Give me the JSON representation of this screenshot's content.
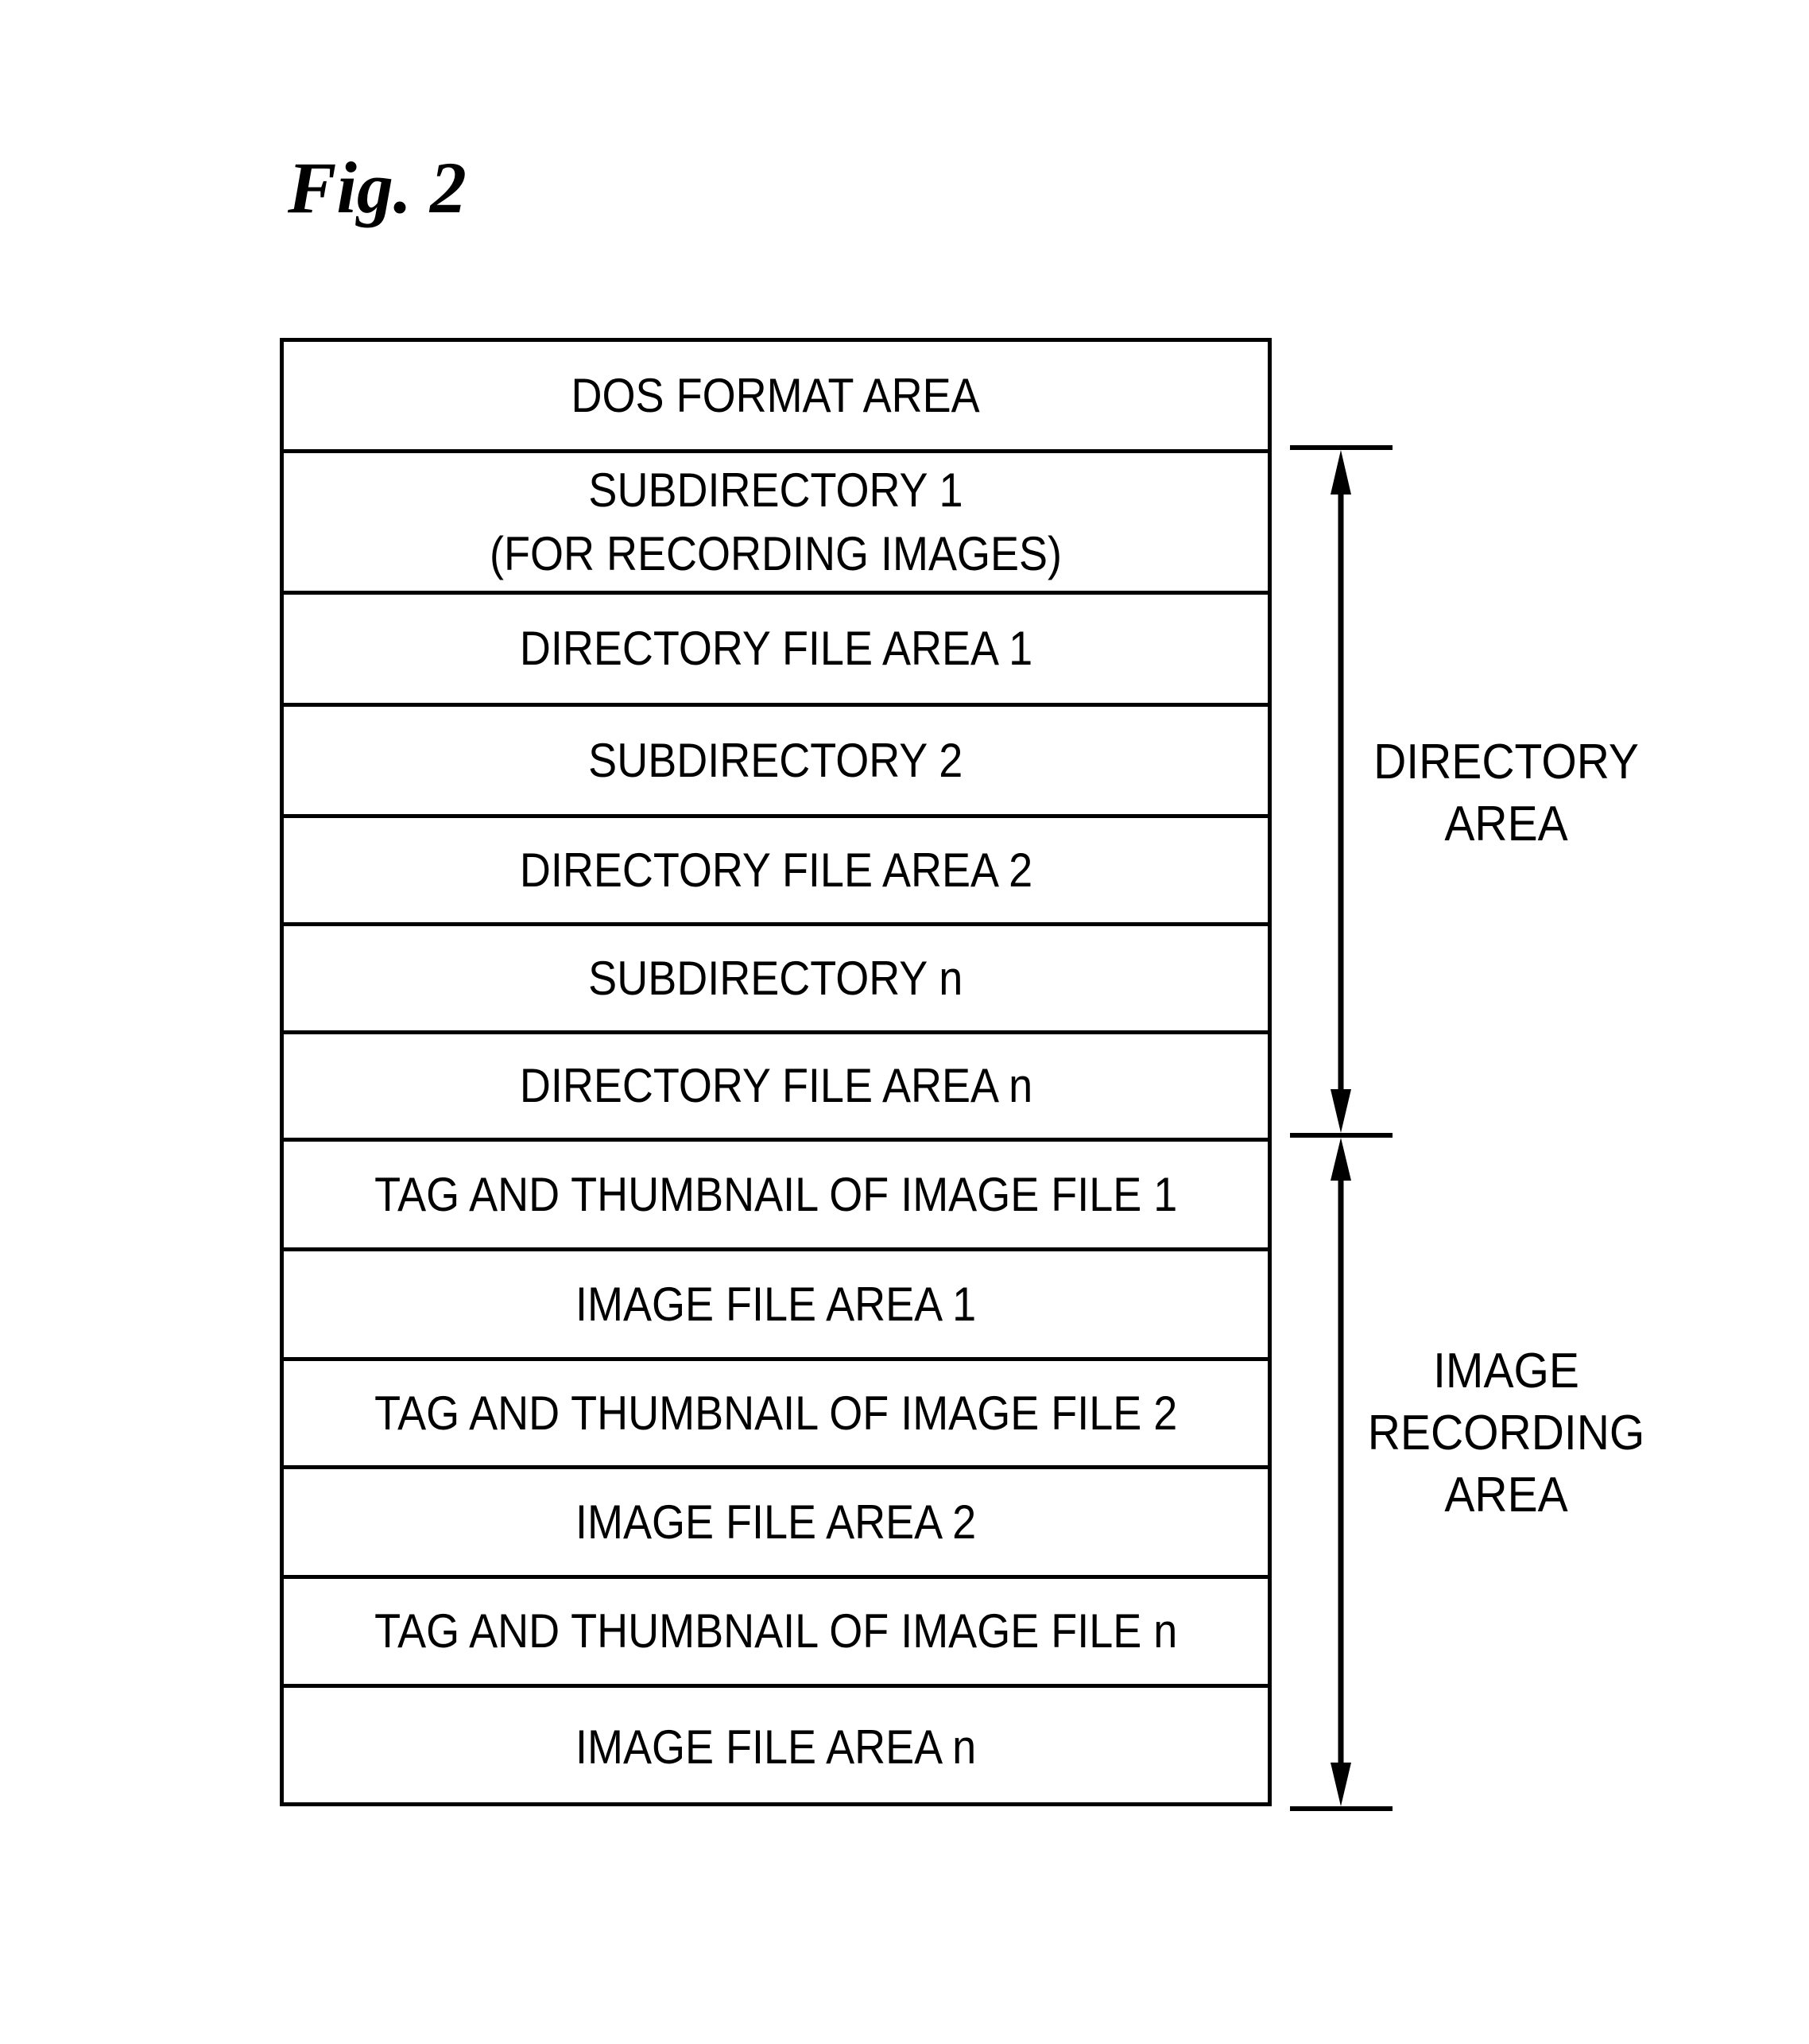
{
  "figure": {
    "title": "Fig. 2"
  },
  "memory_layout": {
    "rows": [
      {
        "label": "DOS FORMAT AREA"
      },
      {
        "label": "SUBDIRECTORY 1\n(FOR RECORDING IMAGES)"
      },
      {
        "label": "DIRECTORY FILE AREA 1"
      },
      {
        "label": "SUBDIRECTORY 2"
      },
      {
        "label": "DIRECTORY FILE AREA 2"
      },
      {
        "label": "SUBDIRECTORY n"
      },
      {
        "label": "DIRECTORY FILE AREA n"
      },
      {
        "label": "TAG AND THUMBNAIL OF IMAGE FILE 1"
      },
      {
        "label": "IMAGE FILE AREA 1"
      },
      {
        "label": "TAG AND THUMBNAIL OF IMAGE FILE 2"
      },
      {
        "label": "IMAGE FILE AREA 2"
      },
      {
        "label": "TAG AND THUMBNAIL OF IMAGE FILE n"
      },
      {
        "label": "IMAGE FILE AREA n"
      }
    ]
  },
  "regions": {
    "directory_area": {
      "lines": [
        "DIRECTORY",
        "AREA"
      ],
      "spans_rows": "SUBDIRECTORY 1 to DIRECTORY FILE AREA n"
    },
    "image_recording_area": {
      "lines": [
        "IMAGE",
        "RECORDING",
        "AREA"
      ],
      "spans_rows": "TAG AND THUMBNAIL OF IMAGE FILE 1 to IMAGE FILE AREA n"
    }
  }
}
